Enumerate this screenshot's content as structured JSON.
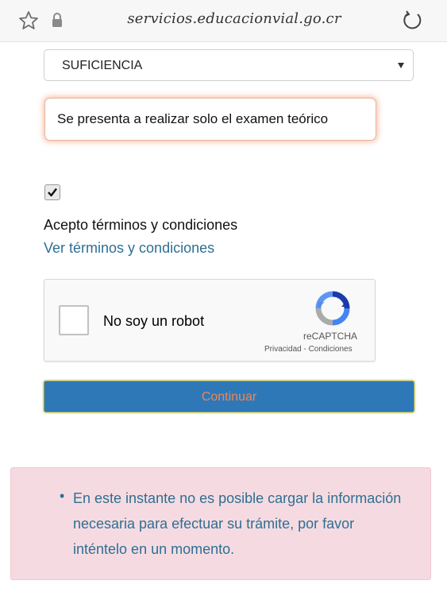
{
  "browser": {
    "url": "servicios.educacionvial.go.cr"
  },
  "form": {
    "select_value": "SUFICIENCIA",
    "notice_text": "Se presenta a realizar solo el examen teórico",
    "terms_checked": true,
    "terms_label": "Acepto términos y condiciones",
    "terms_link": "Ver términos y condiciones",
    "continue_label": "Continuar"
  },
  "captcha": {
    "label": "No soy un robot",
    "brand": "reCAPTCHA",
    "privacy": "Privacidad - Condiciones"
  },
  "alert": {
    "message": "En este instante no es posible cargar la información necesaria para efectuar su trámite, por favor inténtelo en un momento."
  },
  "colors": {
    "link": "#2e6f93",
    "button_bg": "#2f78b8",
    "button_text": "#e8885a",
    "alert_bg": "#f5dbe1"
  }
}
